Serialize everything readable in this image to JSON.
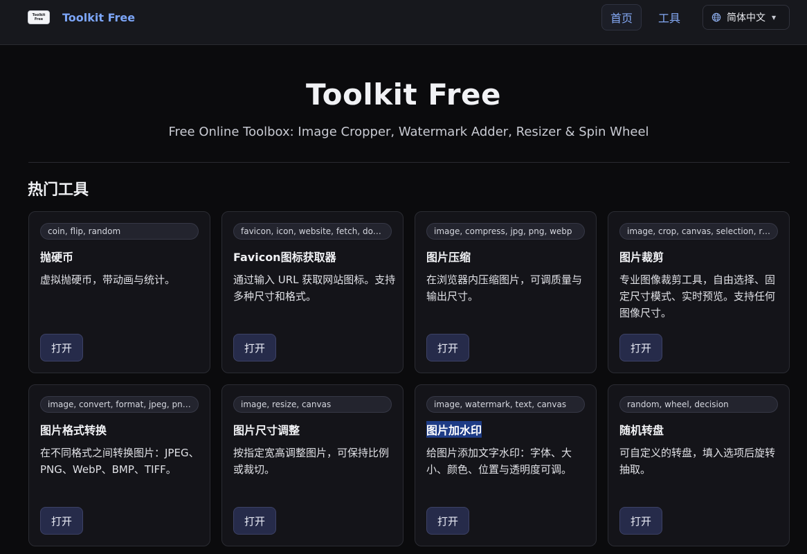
{
  "header": {
    "logo_text_line1": "Toolkit",
    "logo_text_line2": "Free",
    "brand": "Toolkit Free",
    "nav_home": "首页",
    "nav_tools": "工具",
    "language": "简体中文"
  },
  "hero": {
    "title": "Toolkit Free",
    "subtitle": "Free Online Toolbox: Image Cropper, Watermark Adder, Resizer & Spin Wheel"
  },
  "section": {
    "title": "热门工具"
  },
  "cards": [
    {
      "tags": "coin, flip, random",
      "title": "抛硬币",
      "desc": "虚拟抛硬币，带动画与统计。",
      "button": "打开"
    },
    {
      "tags": "favicon, icon, website, fetch, download",
      "title": "Favicon图标获取器",
      "desc": "通过输入 URL 获取网站图标。支持多种尺寸和格式。",
      "button": "打开"
    },
    {
      "tags": "image, compress, jpg, png, webp",
      "title": "图片压缩",
      "desc": "在浏览器内压缩图片，可调质量与输出尺寸。",
      "button": "打开"
    },
    {
      "tags": "image, crop, canvas, selection, resize",
      "title": "图片裁剪",
      "desc": "专业图像裁剪工具，自由选择、固定尺寸模式、实时预览。支持任何图像尺寸。",
      "button": "打开"
    },
    {
      "tags": "image, convert, format, jpeg, png, webp",
      "title": "图片格式转换",
      "desc": "在不同格式之间转换图片：JPEG、PNG、WebP、BMP、TIFF。",
      "button": "打开"
    },
    {
      "tags": "image, resize, canvas",
      "title": "图片尺寸调整",
      "desc": "按指定宽高调整图片，可保持比例或裁切。",
      "button": "打开"
    },
    {
      "tags": "image, watermark, text, canvas",
      "title": "图片加水印",
      "desc": "给图片添加文字水印：字体、大小、颜色、位置与透明度可调。",
      "button": "打开"
    },
    {
      "tags": "random, wheel, decision",
      "title": "随机转盘",
      "desc": "可自定义的转盘，填入选项后旋转抽取。",
      "button": "打开"
    }
  ],
  "colors": {
    "background": "#0b0b0d",
    "header_bg": "#17181d",
    "accent": "#7ca5f7",
    "card_bg": "#141419",
    "button_bg": "#262b4a",
    "selection_highlight": "#1e3c86"
  }
}
